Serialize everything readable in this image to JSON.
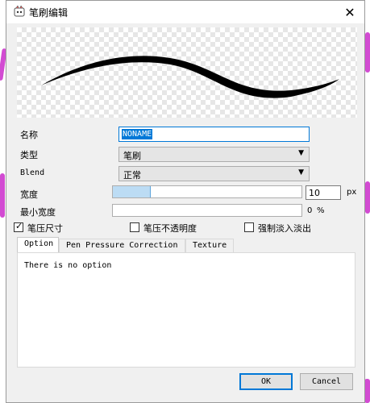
{
  "window": {
    "title": "笔刷编辑"
  },
  "fields": {
    "name_label": "名称",
    "name_value": "NONAME",
    "type_label": "类型",
    "type_value": "笔刷",
    "blend_label": "Blend",
    "blend_value": "正常",
    "width_label": "宽度",
    "width_value": "10",
    "width_unit": "px",
    "width_slider_fraction": 0.2,
    "min_width_label": "最小宽度",
    "min_width_value": "0",
    "min_width_unit": "%",
    "min_width_slider_fraction": 0.0
  },
  "checks": [
    {
      "label": "笔压尺寸",
      "checked": true
    },
    {
      "label": "笔压不透明度",
      "checked": false
    },
    {
      "label": "强制淡入淡出",
      "checked": false
    }
  ],
  "tabs": [
    "Option",
    "Pen Pressure Correction",
    "Texture"
  ],
  "active_tab": "Option",
  "panel": {
    "text": "There is no option"
  },
  "buttons": {
    "ok": "OK",
    "cancel": "Cancel"
  },
  "colors": {
    "accent": "#0078d7",
    "slider_fill": "#bcdcf4"
  },
  "icons": {
    "close": "close-icon",
    "app": "app-icon",
    "dropdown": "chevron-down-icon"
  }
}
